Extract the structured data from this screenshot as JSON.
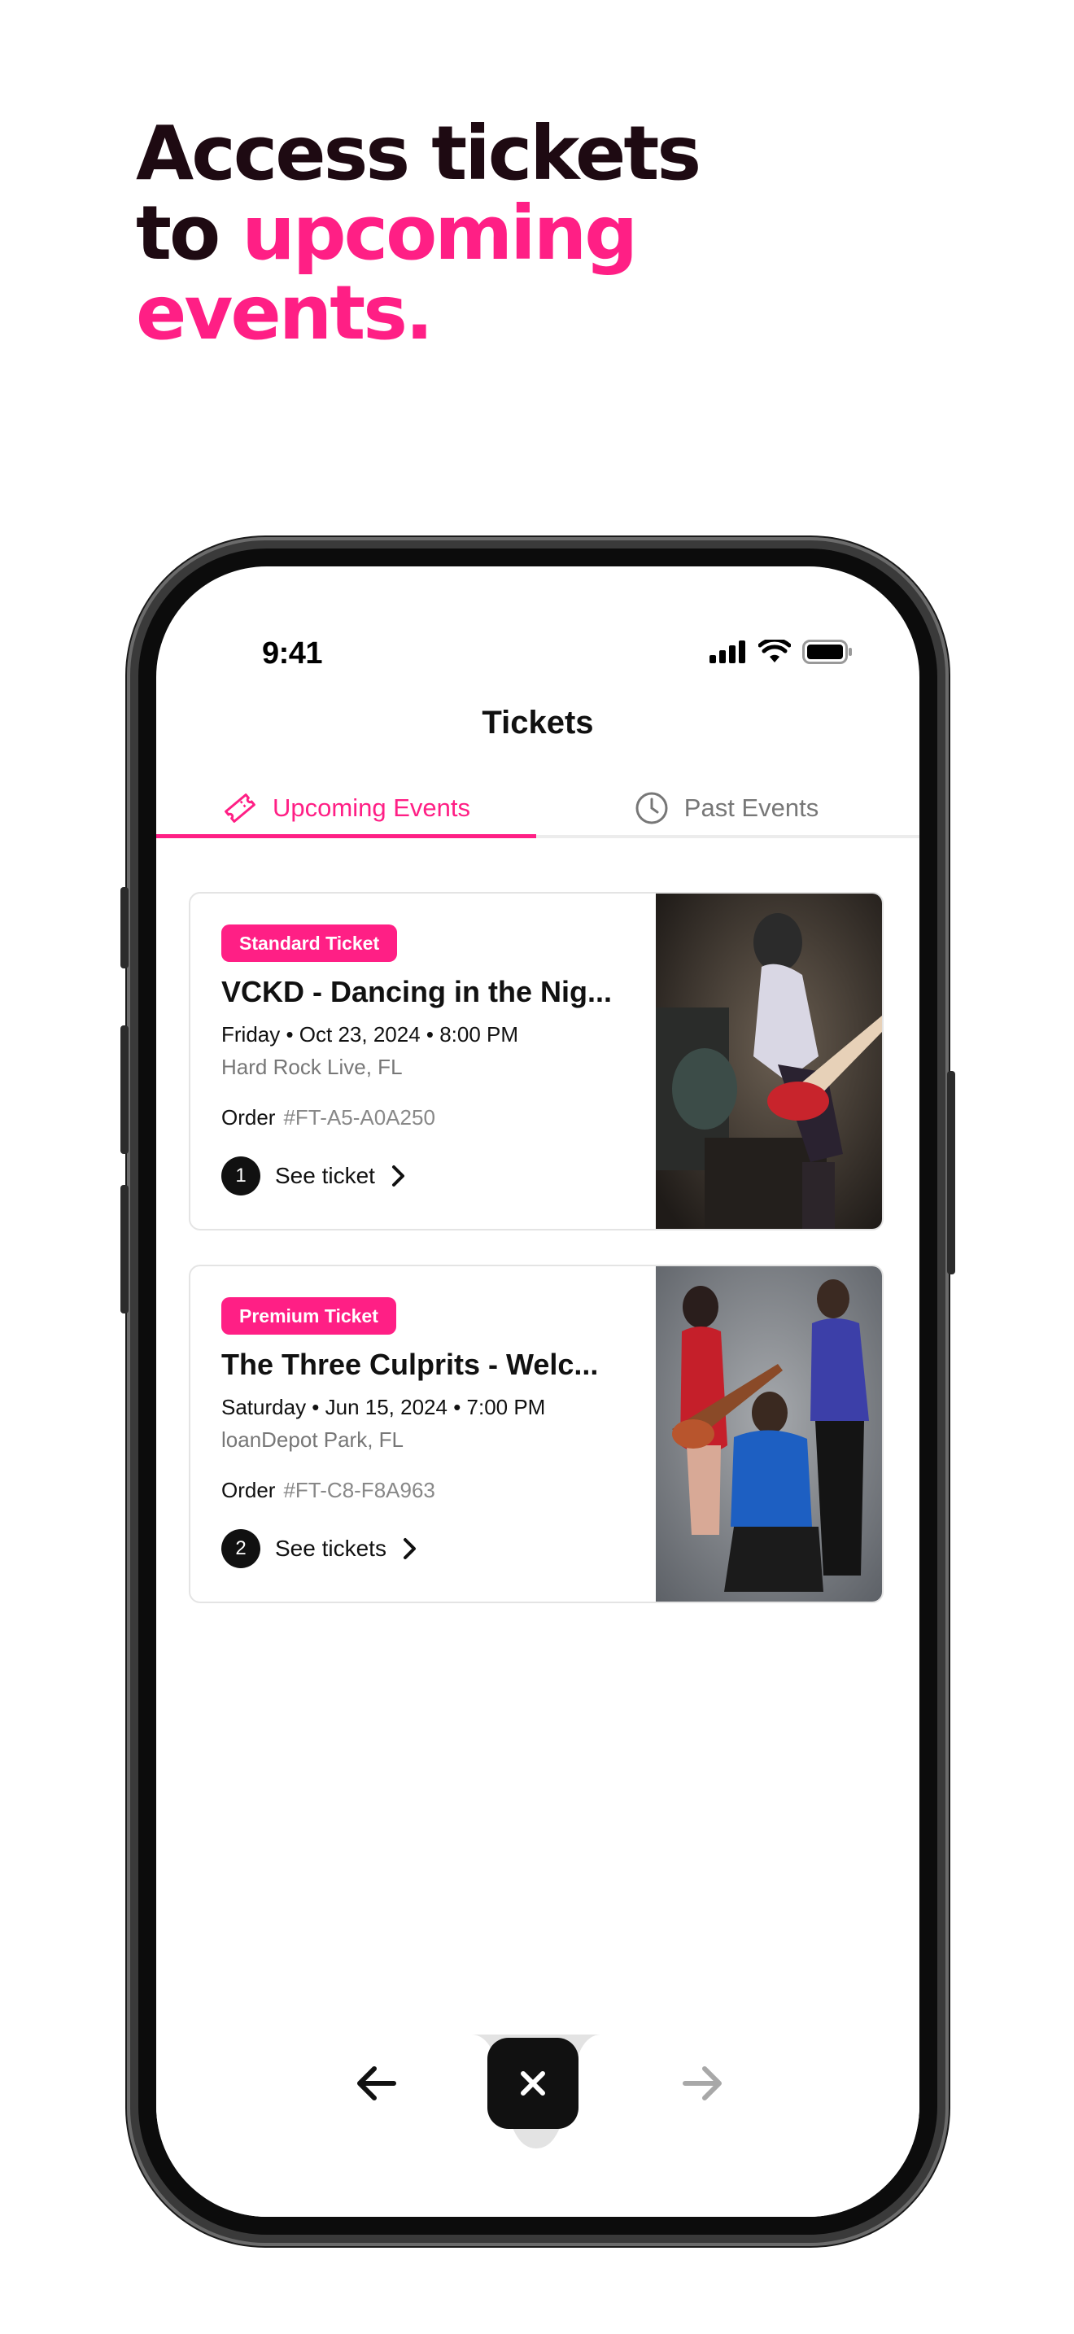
{
  "headline": {
    "line1": "Access tickets",
    "line2_plain": "to ",
    "line2_accent": "upcoming",
    "line3_accent": "events."
  },
  "status_bar": {
    "time": "9:41"
  },
  "screen": {
    "title": "Tickets",
    "tabs": [
      {
        "label": "Upcoming Events",
        "icon": "ticket-icon",
        "active": true
      },
      {
        "label": "Past Events",
        "icon": "clock-icon",
        "active": false
      }
    ],
    "events": [
      {
        "badge": "Standard Ticket",
        "title": "VCKD - Dancing in the Nig...",
        "date": "Friday • Oct 23, 2024 • 8:00 PM",
        "venue": "Hard Rock Live, FL",
        "order_label": "Order",
        "order_code": "#FT-A5-A0A250",
        "ticket_count": "1",
        "action_label": "See ticket"
      },
      {
        "badge": "Premium Ticket",
        "title": "The Three Culprits - Welc...",
        "date": "Saturday • Jun 15, 2024 • 7:00 PM",
        "venue": "loanDepot Park, FL",
        "order_label": "Order",
        "order_code": "#FT-C8-F8A963",
        "ticket_count": "2",
        "action_label": "See tickets"
      }
    ]
  },
  "bottom_bar": {
    "back_icon": "arrow-left-icon",
    "close_icon": "close-icon",
    "forward_icon": "arrow-right-icon"
  },
  "colors": {
    "accent": "#ff1f85",
    "headline_dark": "#1e0a12",
    "text": "#111111",
    "muted": "#777777"
  }
}
